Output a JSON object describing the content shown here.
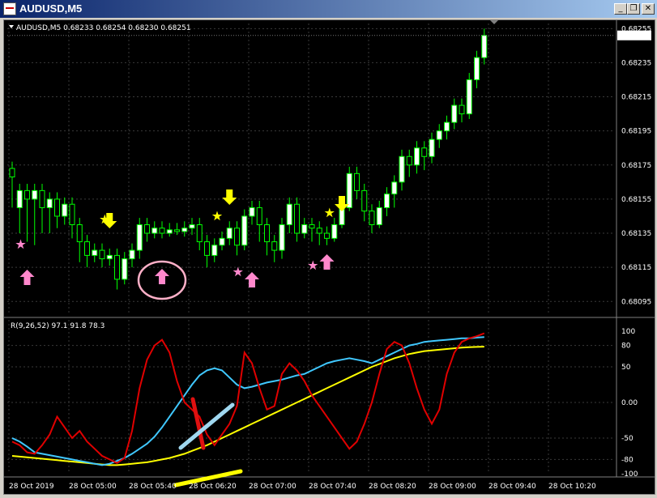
{
  "window": {
    "title": "AUDUSD,M5",
    "minimize_label": "_",
    "restore_label": "❐",
    "close_label": "✕"
  },
  "chart": {
    "header": "AUDUSD,M5  0.68233 0.68254 0.68230 0.68251",
    "current_price": "0.68251",
    "price_axis": [
      "0.68255",
      "0.68235",
      "0.68215",
      "0.68195",
      "0.68175",
      "0.68155",
      "0.68135",
      "0.68115",
      "0.68095"
    ],
    "indicator_header": "R(9,26,52) 97.1 91.8 78.3",
    "indicator_axis": [
      "100",
      "80",
      "50",
      "0.00",
      "-50",
      "-80",
      "-100"
    ],
    "time_axis": [
      "28 Oct 2019",
      "28 Oct 05:00",
      "28 Oct 05:40",
      "28 Oct 06:20",
      "28 Oct 07:00",
      "28 Oct 07:40",
      "28 Oct 08:20",
      "28 Oct 09:00",
      "28 Oct 09:40",
      "28 Oct 10:20"
    ],
    "colors": {
      "background": "#000000",
      "bull_candle": "#ffffff",
      "bear_candle": "#000000",
      "wick": "#00ff00",
      "grid": "#3a3a3a",
      "rsi_fast": "#e00000",
      "rsi_mid": "#40c8ff",
      "rsi_slow": "#ffff00",
      "marker_down_arrow": "#ffff00",
      "marker_up_arrow": "#ff88cc",
      "annotation_circle": "#ffb0c8"
    },
    "markers": [
      {
        "type": "pink-star",
        "time": "05:00"
      },
      {
        "type": "pink-up-arrow",
        "time": "05:00"
      },
      {
        "type": "yellow-star",
        "time": "05:55"
      },
      {
        "type": "yellow-down-arrow",
        "time": "05:55"
      },
      {
        "type": "pink-up-arrow",
        "time": "06:30"
      },
      {
        "type": "yellow-down-arrow",
        "time": "07:15"
      },
      {
        "type": "yellow-star",
        "time": "07:10"
      },
      {
        "type": "pink-star",
        "time": "07:25"
      },
      {
        "type": "pink-up-arrow",
        "time": "07:30"
      },
      {
        "type": "pink-star",
        "time": "08:15"
      },
      {
        "type": "pink-up-arrow",
        "time": "08:20"
      },
      {
        "type": "yellow-star",
        "time": "08:25"
      },
      {
        "type": "yellow-down-arrow",
        "time": "08:30"
      }
    ],
    "candles": [
      [
        0.68173,
        0.68168,
        0.6815
      ],
      [
        0.6815,
        0.6816,
        0.68135
      ],
      [
        0.6816,
        0.68155,
        0.6813
      ],
      [
        0.68155,
        0.6816,
        0.68128
      ],
      [
        0.6816,
        0.6815,
        0.68135
      ],
      [
        0.6815,
        0.68155,
        0.68135
      ],
      [
        0.68155,
        0.68145,
        0.68138
      ],
      [
        0.68145,
        0.68152,
        0.6814
      ],
      [
        0.68152,
        0.6814,
        0.68132
      ],
      [
        0.6814,
        0.6813,
        0.68118
      ],
      [
        0.6813,
        0.68122,
        0.68115
      ],
      [
        0.68122,
        0.68125,
        0.68118
      ],
      [
        0.68125,
        0.6812,
        0.68115
      ],
      [
        0.6812,
        0.68122,
        0.68116
      ],
      [
        0.68122,
        0.68108,
        0.68102
      ],
      [
        0.68108,
        0.6812,
        0.68105
      ],
      [
        0.6812,
        0.68125,
        0.68115
      ],
      [
        0.68125,
        0.6814,
        0.6812
      ],
      [
        0.6814,
        0.68135,
        0.6813
      ],
      [
        0.68135,
        0.68138,
        0.68132
      ],
      [
        0.68138,
        0.68135,
        0.68132
      ],
      [
        0.68135,
        0.68137,
        0.68133
      ],
      [
        0.68137,
        0.68136,
        0.68134
      ],
      [
        0.68136,
        0.68138,
        0.68133
      ],
      [
        0.68138,
        0.6814,
        0.68134
      ],
      [
        0.6814,
        0.6813,
        0.68125
      ],
      [
        0.6813,
        0.68122,
        0.68115
      ],
      [
        0.68122,
        0.68128,
        0.68118
      ],
      [
        0.68128,
        0.68132,
        0.68125
      ],
      [
        0.68132,
        0.68138,
        0.68128
      ],
      [
        0.68138,
        0.68128,
        0.68122
      ],
      [
        0.68128,
        0.68145,
        0.68125
      ],
      [
        0.68145,
        0.6815,
        0.6814
      ],
      [
        0.6815,
        0.6814,
        0.6813
      ],
      [
        0.6814,
        0.6813,
        0.68122
      ],
      [
        0.6813,
        0.68125,
        0.68118
      ],
      [
        0.68125,
        0.6814,
        0.6812
      ],
      [
        0.6814,
        0.68152,
        0.68135
      ],
      [
        0.68152,
        0.68135,
        0.6813
      ],
      [
        0.68135,
        0.6814,
        0.68132
      ],
      [
        0.6814,
        0.68138,
        0.6813
      ],
      [
        0.68138,
        0.68135,
        0.68128
      ],
      [
        0.68135,
        0.68132,
        0.68128
      ],
      [
        0.68132,
        0.6814,
        0.6813
      ],
      [
        0.6814,
        0.6815,
        0.68138
      ],
      [
        0.6815,
        0.6817,
        0.68148
      ],
      [
        0.6817,
        0.6816,
        0.68155
      ],
      [
        0.6816,
        0.68148,
        0.68142
      ],
      [
        0.68148,
        0.6814,
        0.68135
      ],
      [
        0.6814,
        0.6815,
        0.68138
      ],
      [
        0.6815,
        0.68158,
        0.68145
      ],
      [
        0.68158,
        0.68165,
        0.6815
      ],
      [
        0.68165,
        0.6818,
        0.6816
      ],
      [
        0.6818,
        0.68175,
        0.68168
      ],
      [
        0.68175,
        0.68185,
        0.6817
      ],
      [
        0.68185,
        0.6818,
        0.68172
      ],
      [
        0.6818,
        0.6819,
        0.68176
      ],
      [
        0.6819,
        0.68195,
        0.68185
      ],
      [
        0.68195,
        0.682,
        0.6819
      ],
      [
        0.682,
        0.6821,
        0.68196
      ],
      [
        0.6821,
        0.68205,
        0.682
      ],
      [
        0.68205,
        0.68225,
        0.68202
      ],
      [
        0.68225,
        0.68238,
        0.6822
      ],
      [
        0.68238,
        0.68251,
        0.68234
      ]
    ],
    "rsi_fast": [
      -55,
      -60,
      -70,
      -72,
      -60,
      -45,
      -20,
      -35,
      -50,
      -40,
      -55,
      -65,
      -75,
      -80,
      -85,
      -78,
      -40,
      20,
      60,
      80,
      88,
      70,
      30,
      0,
      -10,
      -20,
      -45,
      -60,
      -45,
      -30,
      -5,
      70,
      55,
      20,
      -10,
      -5,
      40,
      55,
      45,
      30,
      10,
      -5,
      -20,
      -35,
      -50,
      -65,
      -55,
      -30,
      0,
      40,
      75,
      85,
      80,
      55,
      20,
      -10,
      -30,
      -10,
      40,
      70,
      85,
      90,
      93,
      97
    ],
    "rsi_mid": [
      -50,
      -55,
      -62,
      -70,
      -72,
      -74,
      -76,
      -78,
      -80,
      -82,
      -84,
      -86,
      -88,
      -86,
      -82,
      -78,
      -72,
      -65,
      -58,
      -48,
      -35,
      -20,
      -5,
      10,
      25,
      38,
      45,
      48,
      45,
      35,
      25,
      20,
      22,
      25,
      28,
      30,
      32,
      35,
      38,
      40,
      45,
      50,
      55,
      58,
      60,
      62,
      60,
      58,
      55,
      60,
      65,
      70,
      75,
      80,
      82,
      85,
      86,
      87,
      88,
      89,
      90,
      90,
      91,
      91.8
    ],
    "rsi_slow": [
      -75,
      -76,
      -77,
      -78,
      -79,
      -80,
      -81,
      -82,
      -83,
      -84,
      -85,
      -86,
      -87,
      -88,
      -88,
      -87,
      -86,
      -85,
      -84,
      -82,
      -80,
      -78,
      -75,
      -72,
      -68,
      -64,
      -60,
      -55,
      -50,
      -45,
      -40,
      -35,
      -30,
      -25,
      -20,
      -15,
      -10,
      -5,
      0,
      5,
      10,
      15,
      20,
      25,
      30,
      35,
      40,
      45,
      50,
      54,
      58,
      62,
      65,
      68,
      70,
      72,
      73,
      74,
      75,
      76,
      77,
      77.5,
      78,
      78.3
    ]
  }
}
